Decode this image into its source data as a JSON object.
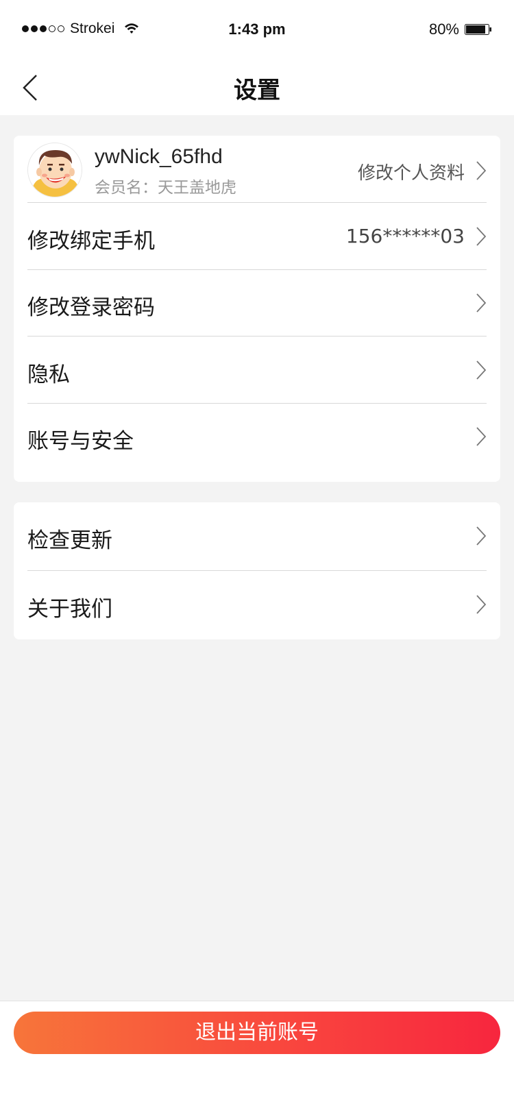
{
  "status_bar": {
    "carrier": "Strokei",
    "time": "1:43 pm",
    "battery": "80%",
    "icons": [
      "signal-icon",
      "wifi-icon",
      "battery-icon"
    ]
  },
  "nav": {
    "title": "设置",
    "back_icon": "chevron-left-icon"
  },
  "profile": {
    "nickname": "ywNick_65fhd",
    "member_label": "会员名：天王盖地虎",
    "edit_label": "修改个人资料"
  },
  "account_items": [
    {
      "label": "修改绑定手机",
      "value": "156******03"
    },
    {
      "label": "修改登录密码",
      "value": ""
    },
    {
      "label": "隐私",
      "value": ""
    },
    {
      "label": "账号与安全",
      "value": ""
    }
  ],
  "app_items": [
    {
      "label": "检查更新"
    },
    {
      "label": "关于我们"
    }
  ],
  "logout": {
    "label": "退出当前账号",
    "gradient_start": "#f7753a",
    "gradient_end": "#f7263e"
  }
}
